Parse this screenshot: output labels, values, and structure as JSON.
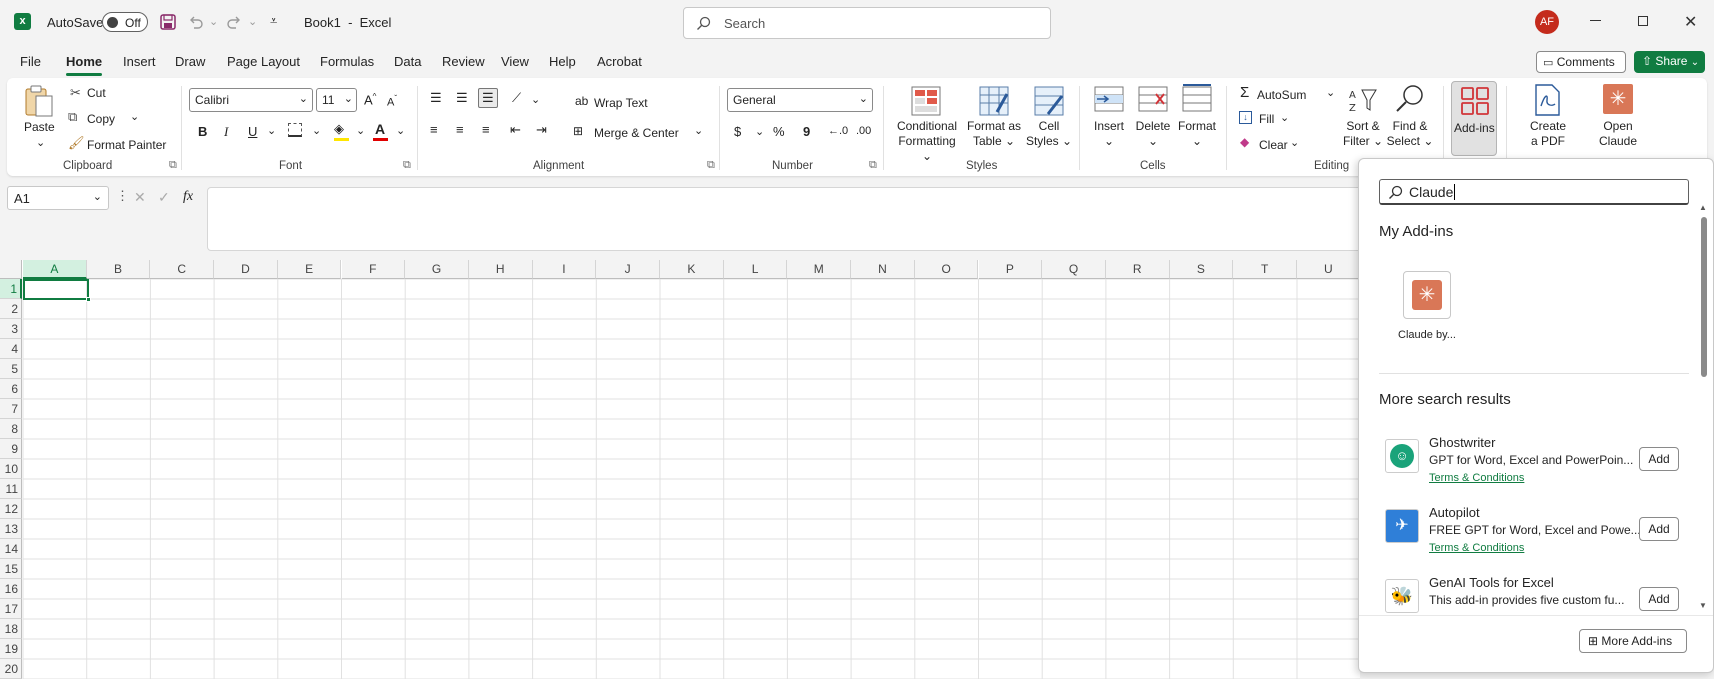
{
  "titlebar": {
    "autosave_label": "AutoSave",
    "autosave_state": "Off",
    "doc_title": "Book1  -  Excel",
    "search_placeholder": "Search",
    "avatar_initials": "AF"
  },
  "menu_tabs": [
    "File",
    "Home",
    "Insert",
    "Draw",
    "Page Layout",
    "Formulas",
    "Data",
    "Review",
    "View",
    "Help",
    "Acrobat"
  ],
  "active_tab": "Home",
  "header_buttons": {
    "comments": "Comments",
    "share": "Share"
  },
  "ribbon": {
    "clipboard": {
      "paste": "Paste",
      "cut": "Cut",
      "copy": "Copy",
      "format_painter": "Format Painter",
      "group": "Clipboard"
    },
    "font": {
      "name": "Calibri",
      "size": "11",
      "group": "Font",
      "bold": "B",
      "italic": "I",
      "underline": "U"
    },
    "alignment": {
      "wrap_text": "Wrap Text",
      "merge_center": "Merge & Center",
      "group": "Alignment"
    },
    "number": {
      "format": "General",
      "currency": "$",
      "percent": "%",
      "comma": "9",
      "group": "Number"
    },
    "styles": {
      "conditional_1": "Conditional",
      "conditional_2": "Formatting",
      "format_table_1": "Format as",
      "format_table_2": "Table",
      "cell_styles_1": "Cell",
      "cell_styles_2": "Styles",
      "group": "Styles"
    },
    "cells": {
      "insert": "Insert",
      "delete": "Delete",
      "format": "Format",
      "group": "Cells"
    },
    "editing": {
      "autosum": "AutoSum",
      "fill": "Fill",
      "clear": "Clear",
      "sort_1": "Sort &",
      "sort_2": "Filter",
      "find_1": "Find &",
      "find_2": "Select",
      "group": "Editing"
    },
    "addins": {
      "label": "Add-ins"
    },
    "acrobat": {
      "create_1": "Create",
      "create_2": "a PDF"
    },
    "claude": {
      "open_1": "Open",
      "open_2": "Claude"
    }
  },
  "formula_bar": {
    "name_box": "A1",
    "fx": "fx",
    "value": ""
  },
  "columns": [
    "A",
    "B",
    "C",
    "D",
    "E",
    "F",
    "G",
    "H",
    "I",
    "J",
    "K",
    "L",
    "M",
    "N",
    "O",
    "P",
    "Q",
    "R",
    "S",
    "T",
    "U"
  ],
  "rows": [
    "1",
    "2",
    "3",
    "4",
    "5",
    "6",
    "7",
    "8",
    "9",
    "10",
    "11",
    "12",
    "13",
    "14",
    "15",
    "16",
    "17",
    "18",
    "19",
    "20"
  ],
  "addins_panel": {
    "search_value": "Claude",
    "my_addins_heading": "My Add-ins",
    "my_addins": [
      {
        "name": "Claude by..."
      }
    ],
    "more_heading": "More search results",
    "results": [
      {
        "title": "Ghostwriter",
        "desc": "GPT for Word, Excel and PowerPoin...",
        "link": "Terms & Conditions",
        "button": "Add"
      },
      {
        "title": "Autopilot",
        "desc": "FREE GPT for Word, Excel and Powe...",
        "link": "Terms & Conditions",
        "button": "Add"
      },
      {
        "title": "GenAI Tools for Excel",
        "desc": "This add-in provides five custom fu...",
        "link": "",
        "button": "Add"
      }
    ],
    "more_addins_button": "More Add-ins"
  },
  "colors": {
    "excel_green": "#107c41",
    "claude_orange": "#d97757",
    "accent_red": "#c42b1c"
  }
}
